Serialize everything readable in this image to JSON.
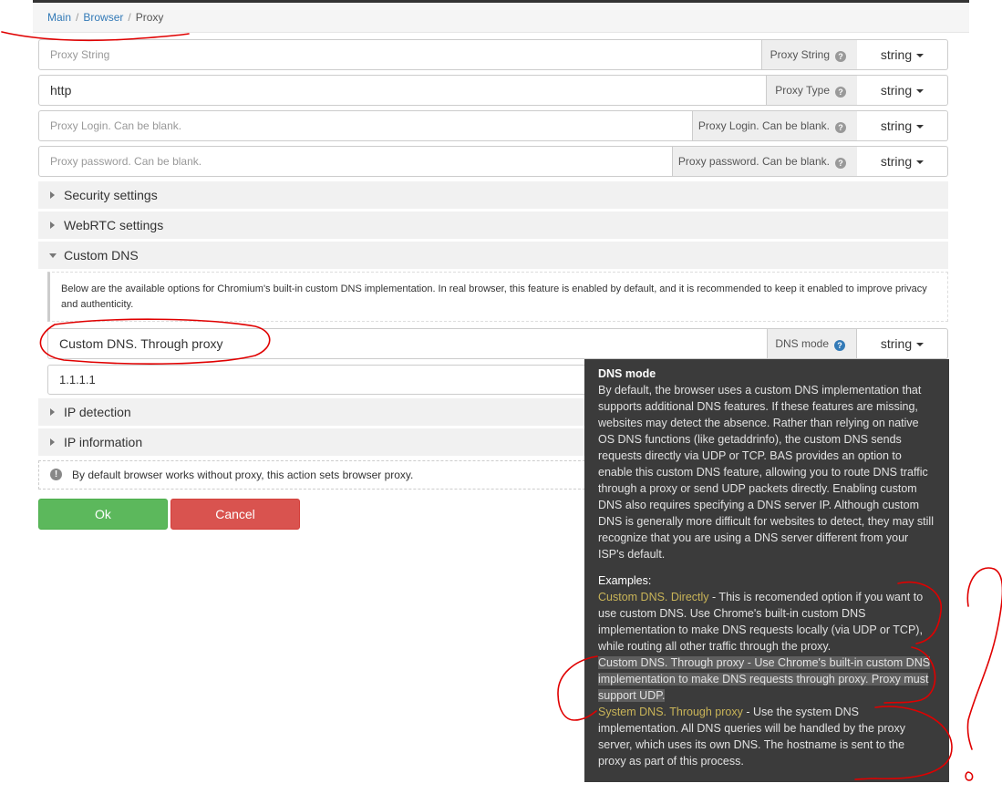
{
  "breadcrumb": {
    "main": "Main",
    "browser": "Browser",
    "current": "Proxy"
  },
  "fields": {
    "proxy_string": {
      "placeholder": "Proxy String",
      "label": "Proxy String",
      "type": "string"
    },
    "proxy_type": {
      "value": "http",
      "label": "Proxy Type",
      "type": "string"
    },
    "proxy_login": {
      "placeholder": "Proxy Login. Can be blank.",
      "label": "Proxy Login. Can be blank.",
      "type": "string"
    },
    "proxy_password": {
      "placeholder": "Proxy password. Can be blank.",
      "label": "Proxy password. Can be blank.",
      "type": "string"
    }
  },
  "sections": {
    "security": "Security settings",
    "webrtc": "WebRTC settings",
    "custom_dns": "Custom DNS",
    "ip_detection": "IP detection",
    "ip_information": "IP information"
  },
  "custom_dns": {
    "notice": "Below are the available options for Chromium's built-in custom DNS implementation. In real browser, this feature is enabled by default, and it is recommended to keep it enabled to improve privacy and authenticity.",
    "mode_value": "Custom DNS. Through proxy",
    "mode_label": "DNS mode",
    "mode_type": "string",
    "server_value": "1.1.1.1"
  },
  "info": "By default browser works without proxy, this action sets browser proxy.",
  "buttons": {
    "ok": "Ok",
    "cancel": "Cancel"
  },
  "tooltip": {
    "title": "DNS mode",
    "body": "By default, the browser uses a custom DNS implementation that supports additional DNS features. If these features are missing, websites may detect the absence. Rather than relying on native OS DNS functions (like getaddrinfo), the custom DNS sends requests directly via UDP or TCP. BAS provides an option to enable this custom DNS feature, allowing you to route DNS traffic through a proxy or send UDP packets directly. Enabling custom DNS also requires specifying a DNS server IP. Although custom DNS is generally more difficult for websites to detect, they may still recognize that you are using a DNS server different from your ISP's default.",
    "examples_title": "Examples:",
    "examples": [
      {
        "name": "Custom DNS. Directly",
        "desc": " - This is recomended option if you want to use custom DNS. Use Chrome's built-in custom DNS implementation to make DNS requests locally (via UDP or TCP), while routing all other traffic through the proxy."
      },
      {
        "name": "Custom DNS. Through proxy",
        "desc": " - Use Chrome's built-in custom DNS implementation to make DNS requests through proxy. Proxy must support UDP."
      },
      {
        "name": "System DNS. Through proxy",
        "desc": " - Use the system DNS implementation. All DNS queries will be handled by the proxy server, which uses its own DNS. The hostname is sent to the proxy as part of this process."
      }
    ]
  },
  "colors": {
    "annotation": "#e00000",
    "tooltip_bg": "#3b3b3b",
    "option_name": "#c9b458",
    "ok": "#5cb85c",
    "cancel": "#d9534f",
    "link": "#337ab7"
  }
}
